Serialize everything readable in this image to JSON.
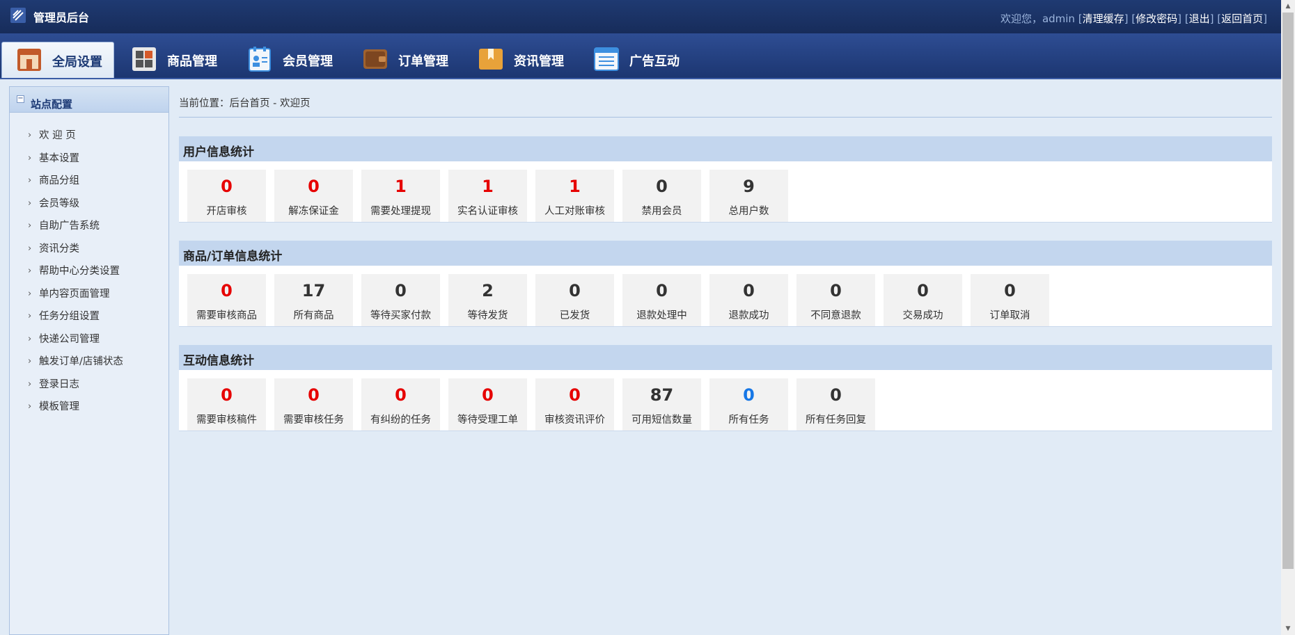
{
  "header": {
    "app_title": "管理员后台",
    "welcome": "欢迎您，admin",
    "links": [
      "清理缓存",
      "修改密码",
      "退出",
      "返回首页"
    ]
  },
  "nav": {
    "tabs": [
      {
        "label": "全局设置",
        "icon": "settings-folder-icon",
        "active": true,
        "color": "#c25a2a"
      },
      {
        "label": "商品管理",
        "icon": "grid-products-icon",
        "active": false,
        "color": "#7b7b7b"
      },
      {
        "label": "会员管理",
        "icon": "member-card-icon",
        "active": false,
        "color": "#3d8fe0"
      },
      {
        "label": "订单管理",
        "icon": "wallet-order-icon",
        "active": false,
        "color": "#a0622e"
      },
      {
        "label": "资讯管理",
        "icon": "news-folder-icon",
        "active": false,
        "color": "#e8a23a"
      },
      {
        "label": "广告互动",
        "icon": "ad-window-icon",
        "active": false,
        "color": "#3d8fe0"
      }
    ]
  },
  "sidebar": {
    "title": "站点配置",
    "items": [
      "欢 迎 页",
      "基本设置",
      "商品分组",
      "会员等级",
      "自助广告系统",
      "资讯分类",
      "帮助中心分类设置",
      "单内容页面管理",
      "任务分组设置",
      "快递公司管理",
      "触发订单/店铺状态",
      "登录日志",
      "模板管理"
    ]
  },
  "main": {
    "breadcrumb": "当前位置：后台首页 - 欢迎页",
    "sections": [
      {
        "title": "用户信息统计",
        "cards": [
          {
            "value": "0",
            "label": "开店审核",
            "num_color": "red",
            "label_color": "dark"
          },
          {
            "value": "0",
            "label": "解冻保证金",
            "num_color": "red",
            "label_color": "dark"
          },
          {
            "value": "1",
            "label": "需要处理提现",
            "num_color": "red",
            "label_color": "dark"
          },
          {
            "value": "1",
            "label": "实名认证审核",
            "num_color": "red",
            "label_color": "dark"
          },
          {
            "value": "1",
            "label": "人工对账审核",
            "num_color": "red",
            "label_color": "dark"
          },
          {
            "value": "0",
            "label": "禁用会员",
            "num_color": "dark",
            "label_color": "dark"
          },
          {
            "value": "9",
            "label": "总用户数",
            "num_color": "dark",
            "label_color": "dark"
          }
        ]
      },
      {
        "title": "商品/订单信息统计",
        "cards": [
          {
            "value": "0",
            "label": "需要审核商品",
            "num_color": "red",
            "label_color": "dark"
          },
          {
            "value": "17",
            "label": "所有商品",
            "num_color": "dark",
            "label_color": "dark"
          },
          {
            "value": "0",
            "label": "等待买家付款",
            "num_color": "dark",
            "label_color": "gray"
          },
          {
            "value": "2",
            "label": "等待发货",
            "num_color": "dark",
            "label_color": "red"
          },
          {
            "value": "0",
            "label": "已发货",
            "num_color": "dark",
            "label_color": "navy"
          },
          {
            "value": "0",
            "label": "退款处理中",
            "num_color": "dark",
            "label_color": "orange"
          },
          {
            "value": "0",
            "label": "退款成功",
            "num_color": "dark",
            "label_color": "gray"
          },
          {
            "value": "0",
            "label": "不同意退款",
            "num_color": "dark",
            "label_color": "red"
          },
          {
            "value": "0",
            "label": "交易成功",
            "num_color": "dark",
            "label_color": "green"
          },
          {
            "value": "0",
            "label": "订单取消",
            "num_color": "dark",
            "label_color": "gray"
          }
        ]
      },
      {
        "title": "互动信息统计",
        "cards": [
          {
            "value": "0",
            "label": "需要审核稿件",
            "num_color": "red",
            "label_color": "dark"
          },
          {
            "value": "0",
            "label": "需要审核任务",
            "num_color": "red",
            "label_color": "dark"
          },
          {
            "value": "0",
            "label": "有纠纷的任务",
            "num_color": "red",
            "label_color": "dark"
          },
          {
            "value": "0",
            "label": "等待受理工单",
            "num_color": "red",
            "label_color": "dark"
          },
          {
            "value": "0",
            "label": "审核资讯评价",
            "num_color": "red",
            "label_color": "dark"
          },
          {
            "value": "87",
            "label": "可用短信数量",
            "num_color": "dark",
            "label_color": "dark"
          },
          {
            "value": "0",
            "label": "所有任务",
            "num_color": "blue",
            "label_color": "blue"
          },
          {
            "value": "0",
            "label": "所有任务回复",
            "num_color": "dark",
            "label_color": "dark"
          }
        ]
      }
    ]
  }
}
